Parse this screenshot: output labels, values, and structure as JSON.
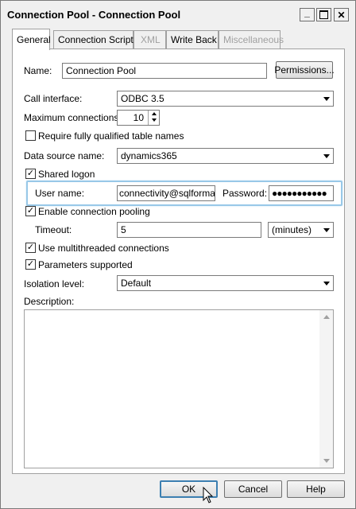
{
  "window": {
    "title": "Connection Pool - Connection Pool",
    "minimize_glyph": "_",
    "maximize_glyph": "□",
    "close_glyph": "✕"
  },
  "tabs": [
    {
      "label": "General",
      "state": "active"
    },
    {
      "label": "Connection Scripts",
      "state": "normal"
    },
    {
      "label": "XML",
      "state": "disabled"
    },
    {
      "label": "Write Back",
      "state": "normal"
    },
    {
      "label": "Miscellaneous",
      "state": "disabled"
    }
  ],
  "form": {
    "name_label": "Name:",
    "name_value": "Connection Pool",
    "permissions_button": "Permissions...",
    "call_interface_label": "Call interface:",
    "call_interface_value": "ODBC 3.5",
    "max_connections_label": "Maximum connections:",
    "max_connections_value": "10",
    "require_qualified_label": "Require fully qualified table names",
    "require_qualified_checked": false,
    "data_source_label": "Data source name:",
    "data_source_value": "dynamics365",
    "shared_logon_label": "Shared logon",
    "shared_logon_checked": true,
    "user_name_label": "User name:",
    "user_name_value": "connectivity@sqlformatc",
    "password_label": "Password:",
    "password_value": "●●●●●●●●●●●",
    "enable_pooling_label": "Enable connection pooling",
    "enable_pooling_checked": true,
    "timeout_label": "Timeout:",
    "timeout_value": "5",
    "timeout_unit": "(minutes)",
    "multithreaded_label": "Use multithreaded connections",
    "multithreaded_checked": true,
    "params_supported_label": "Parameters supported",
    "params_supported_checked": true,
    "isolation_label": "Isolation level:",
    "isolation_value": "Default",
    "description_label": "Description:",
    "description_value": ""
  },
  "footer": {
    "ok": "OK",
    "cancel": "Cancel",
    "help": "Help"
  },
  "colors": {
    "focus_frame": "#98c8e8",
    "disabled_text": "#a0a0a0"
  }
}
